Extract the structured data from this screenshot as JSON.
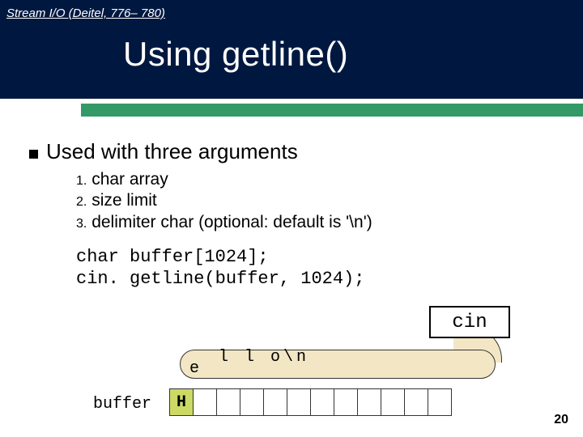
{
  "header": {
    "breadcrumb": "Stream I/O (Deitel, 776– 780)",
    "title": "Using getline()"
  },
  "main": {
    "bullet": "Used with three arguments",
    "items": [
      {
        "num": "1.",
        "text": "char array"
      },
      {
        "num": "2.",
        "text": "size limit"
      },
      {
        "num": "3.",
        "text": "delimiter char (optional: default is '\\n')"
      }
    ],
    "code": [
      "char buffer[1024];",
      "cin. getline(buffer, 1024);"
    ]
  },
  "diagram": {
    "cin_label": "cin",
    "stream_chars": "l l o\\n",
    "stream_e": "e",
    "buffer_label": "buffer",
    "buffer_first": "H",
    "buffer_cells": 12
  },
  "page_number": "20"
}
